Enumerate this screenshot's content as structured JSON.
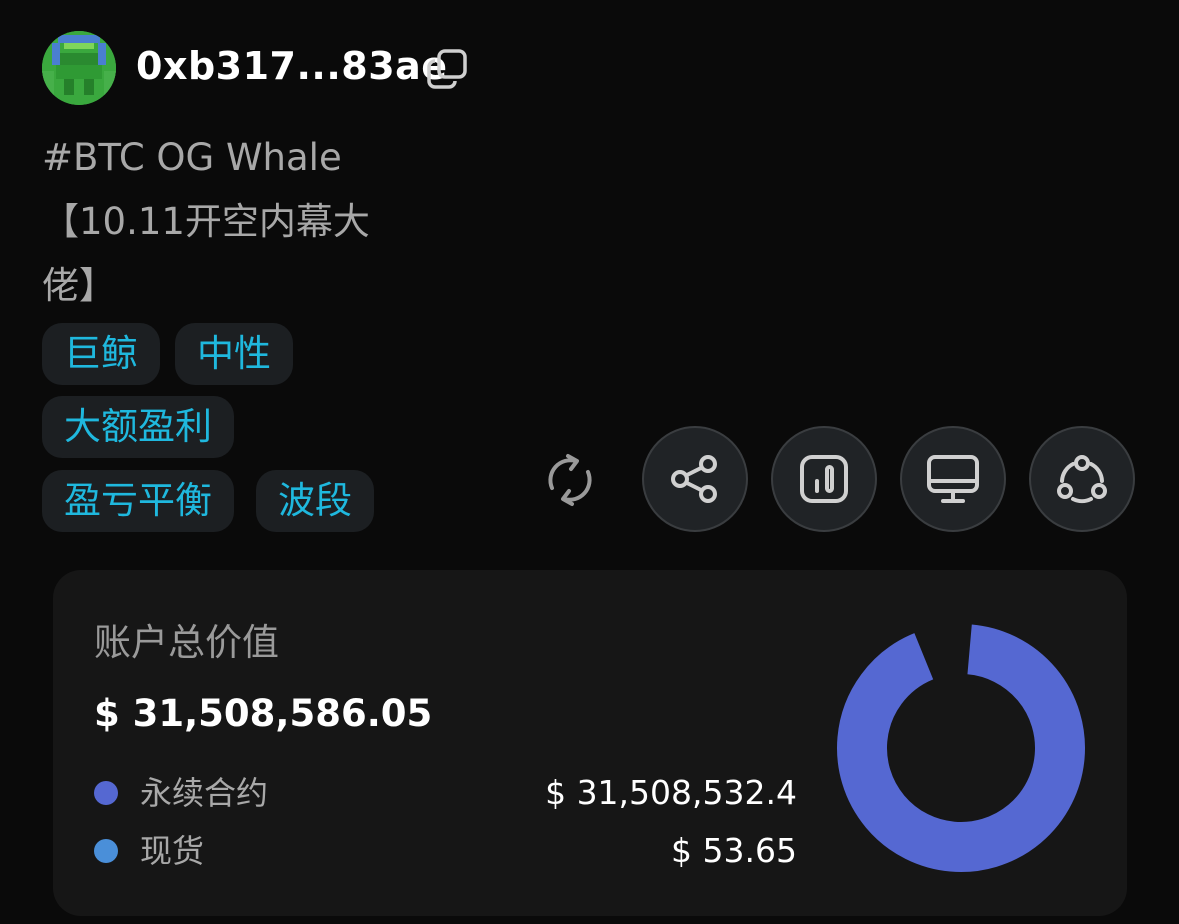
{
  "profile": {
    "address": "0xb317...83ae",
    "bio_line1": "#BTC OG Whale",
    "bio_line2": "【10.11开空内幕大",
    "bio_line3": "佬】"
  },
  "tags": [
    "巨鲸",
    "中性",
    "大额盈利",
    "盈亏平衡",
    "波段"
  ],
  "actions": {
    "refresh": "refresh-icon",
    "share": "share-icon",
    "chart": "bar-chart-icon",
    "monitor": "monitor-icon",
    "network": "network-icon"
  },
  "account": {
    "title": "账户总价值",
    "total": "$ 31,508,586.05",
    "items": [
      {
        "label": "永续合约",
        "value": "$ 31,508,532.4",
        "color": "#5568d2"
      },
      {
        "label": "现货",
        "value": "$ 53.65",
        "color": "#4a8fd9"
      }
    ]
  },
  "colors": {
    "accent": "#1fb8de",
    "tag_bg": "#1c1f22",
    "donut": "#5568d2"
  }
}
